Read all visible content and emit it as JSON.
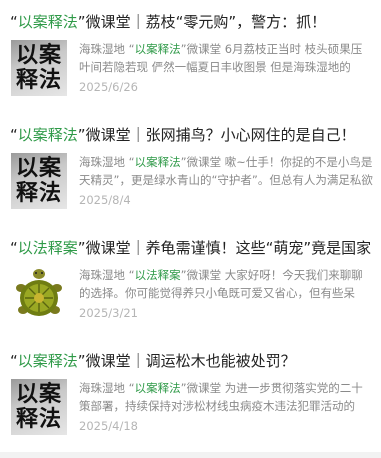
{
  "articles": [
    {
      "title_quote_open": "“",
      "title_tag": "以案释法",
      "title_rest": "”微课堂｜荔枝“零元购”，警方：抓！",
      "thumb_line1": "以案",
      "thumb_line2": "释法",
      "snippet_prefix": "海珠湿地 “",
      "snippet_tag": "以案释法",
      "snippet_line1_rest": "”微课堂 6月荔枝正当时 枝头硕果压",
      "snippet_line2": "叶间若隐若现 俨然一幅夏日丰收图景 但是海珠湿地的",
      "date": "2025/6/26"
    },
    {
      "title_quote_open": "“",
      "title_tag": "以案释法",
      "title_rest": "”微课堂｜张网捕鸟？小心网住的是自己！",
      "thumb_line1": "以案",
      "thumb_line2": "释法",
      "snippet_prefix": "海珠湿地 “",
      "snippet_tag": "以案释法",
      "snippet_line1_rest": "”微课堂 嗽~仕手！你捉的不是小鸟是",
      "snippet_line2": "天精灵”，更是绿水青山的“守护者”。但总有人为满足私欲",
      "date": "2025/8/4"
    },
    {
      "title_quote_open": "“",
      "title_tag": "以法释案",
      "title_rest": "”微课堂｜养龟需谨慎！这些“萌宠”竟是国家",
      "thumb_line1": "",
      "thumb_line2": "",
      "snippet_prefix": "海珠湿地 “",
      "snippet_tag": "以法释案",
      "snippet_line1_rest": "”微课堂 大家好呀！今天我们来聊聊",
      "snippet_line2": "的选择。你可能觉得养只小龟既可爱又省心，但有些呆",
      "date": "2025/3/21"
    },
    {
      "title_quote_open": "“",
      "title_tag": "以案释法",
      "title_rest": "”微课堂｜调运松木也能被处罚？",
      "thumb_line1": "以案",
      "thumb_line2": "释法",
      "snippet_prefix": "海珠湿地 “",
      "snippet_tag": "以案释法",
      "snippet_line1_rest": "”微课堂 为进一步贯彻落实党的二十",
      "snippet_line2": "策部署，持续保持对涉松材线虫病疫木违法犯罪活动的",
      "date": "2025/4/18"
    }
  ],
  "colors": {
    "accent_green": "#2f9a48",
    "title_text": "#222222",
    "snippet_text": "#8a8a8a",
    "date_text": "#b5b5b5"
  }
}
